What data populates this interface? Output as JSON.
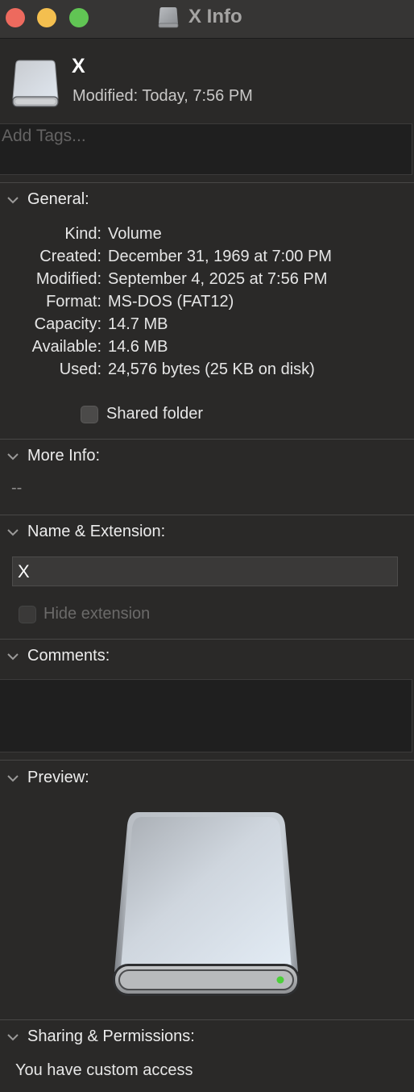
{
  "window": {
    "title": "X Info",
    "icon": "external-drive-icon",
    "buttons": [
      "close",
      "minimize",
      "zoom"
    ]
  },
  "header": {
    "name": "X",
    "modified": "Modified:  Today, 7:56 PM",
    "icon": "external-drive-icon"
  },
  "tags": {
    "placeholder": "Add Tags..."
  },
  "general": {
    "label": "General:",
    "rows": [
      {
        "key": "Kind:",
        "value": "Volume"
      },
      {
        "key": "Created:",
        "value": "December 31, 1969 at 7:00 PM"
      },
      {
        "key": "Modified:",
        "value": "September 4, 2025 at 7:56 PM"
      },
      {
        "key": "Format:",
        "value": "MS-DOS (FAT12)"
      },
      {
        "key": "Capacity:",
        "value": "14.7 MB"
      },
      {
        "key": "Available:",
        "value": "14.6 MB"
      },
      {
        "key": "Used:",
        "value": "24,576 bytes (25 KB on disk)"
      }
    ],
    "shared_folder_label": "Shared folder",
    "shared_folder_checked": false
  },
  "more_info": {
    "label": "More Info:",
    "value": "--"
  },
  "name_extension": {
    "label": "Name & Extension:",
    "value": "X",
    "hide_extension_label": "Hide extension",
    "hide_extension_checked": false,
    "hide_extension_enabled": false
  },
  "comments": {
    "label": "Comments:",
    "value": ""
  },
  "preview": {
    "label": "Preview:",
    "icon": "external-drive-icon"
  },
  "sharing": {
    "label": "Sharing & Permissions:",
    "access": "You have custom access"
  },
  "colors": {
    "background": "#2a2928",
    "close": "#ed6a5e",
    "minimize": "#f4bf4f",
    "zoom": "#61c554",
    "drive_led": "#4ccf3a"
  }
}
